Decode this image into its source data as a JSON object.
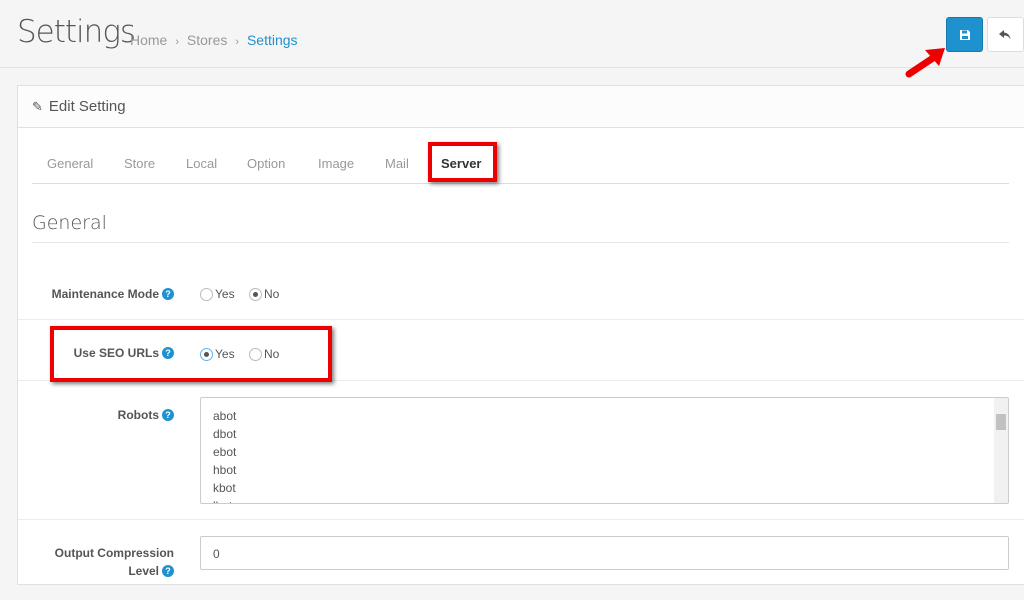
{
  "header": {
    "title": "Settings",
    "breadcrumb": [
      "Home",
      "Stores",
      "Settings"
    ],
    "separator": "›"
  },
  "toolbar": {
    "save_icon": "floppy-disk-icon",
    "back_icon": "reply-icon",
    "accent": "#1e91cf"
  },
  "panel": {
    "heading": "Edit Setting",
    "heading_icon": "pencil-icon"
  },
  "tabs": [
    {
      "label": "General"
    },
    {
      "label": "Store"
    },
    {
      "label": "Local"
    },
    {
      "label": "Option"
    },
    {
      "label": "Image"
    },
    {
      "label": "Mail"
    },
    {
      "label": "Server",
      "active": true
    }
  ],
  "section": {
    "legend": "General"
  },
  "fields": {
    "maintenance": {
      "label": "Maintenance Mode",
      "yes": "Yes",
      "no": "No",
      "value": "No"
    },
    "seo": {
      "label": "Use SEO URLs",
      "yes": "Yes",
      "no": "No",
      "value": "Yes"
    },
    "robots": {
      "label": "Robots",
      "lines": [
        "abot",
        "dbot",
        "ebot",
        "hbot",
        "kbot",
        "lbot"
      ]
    },
    "compression": {
      "label": "Output Compression Level",
      "value": "0"
    }
  },
  "help_glyph": "?"
}
